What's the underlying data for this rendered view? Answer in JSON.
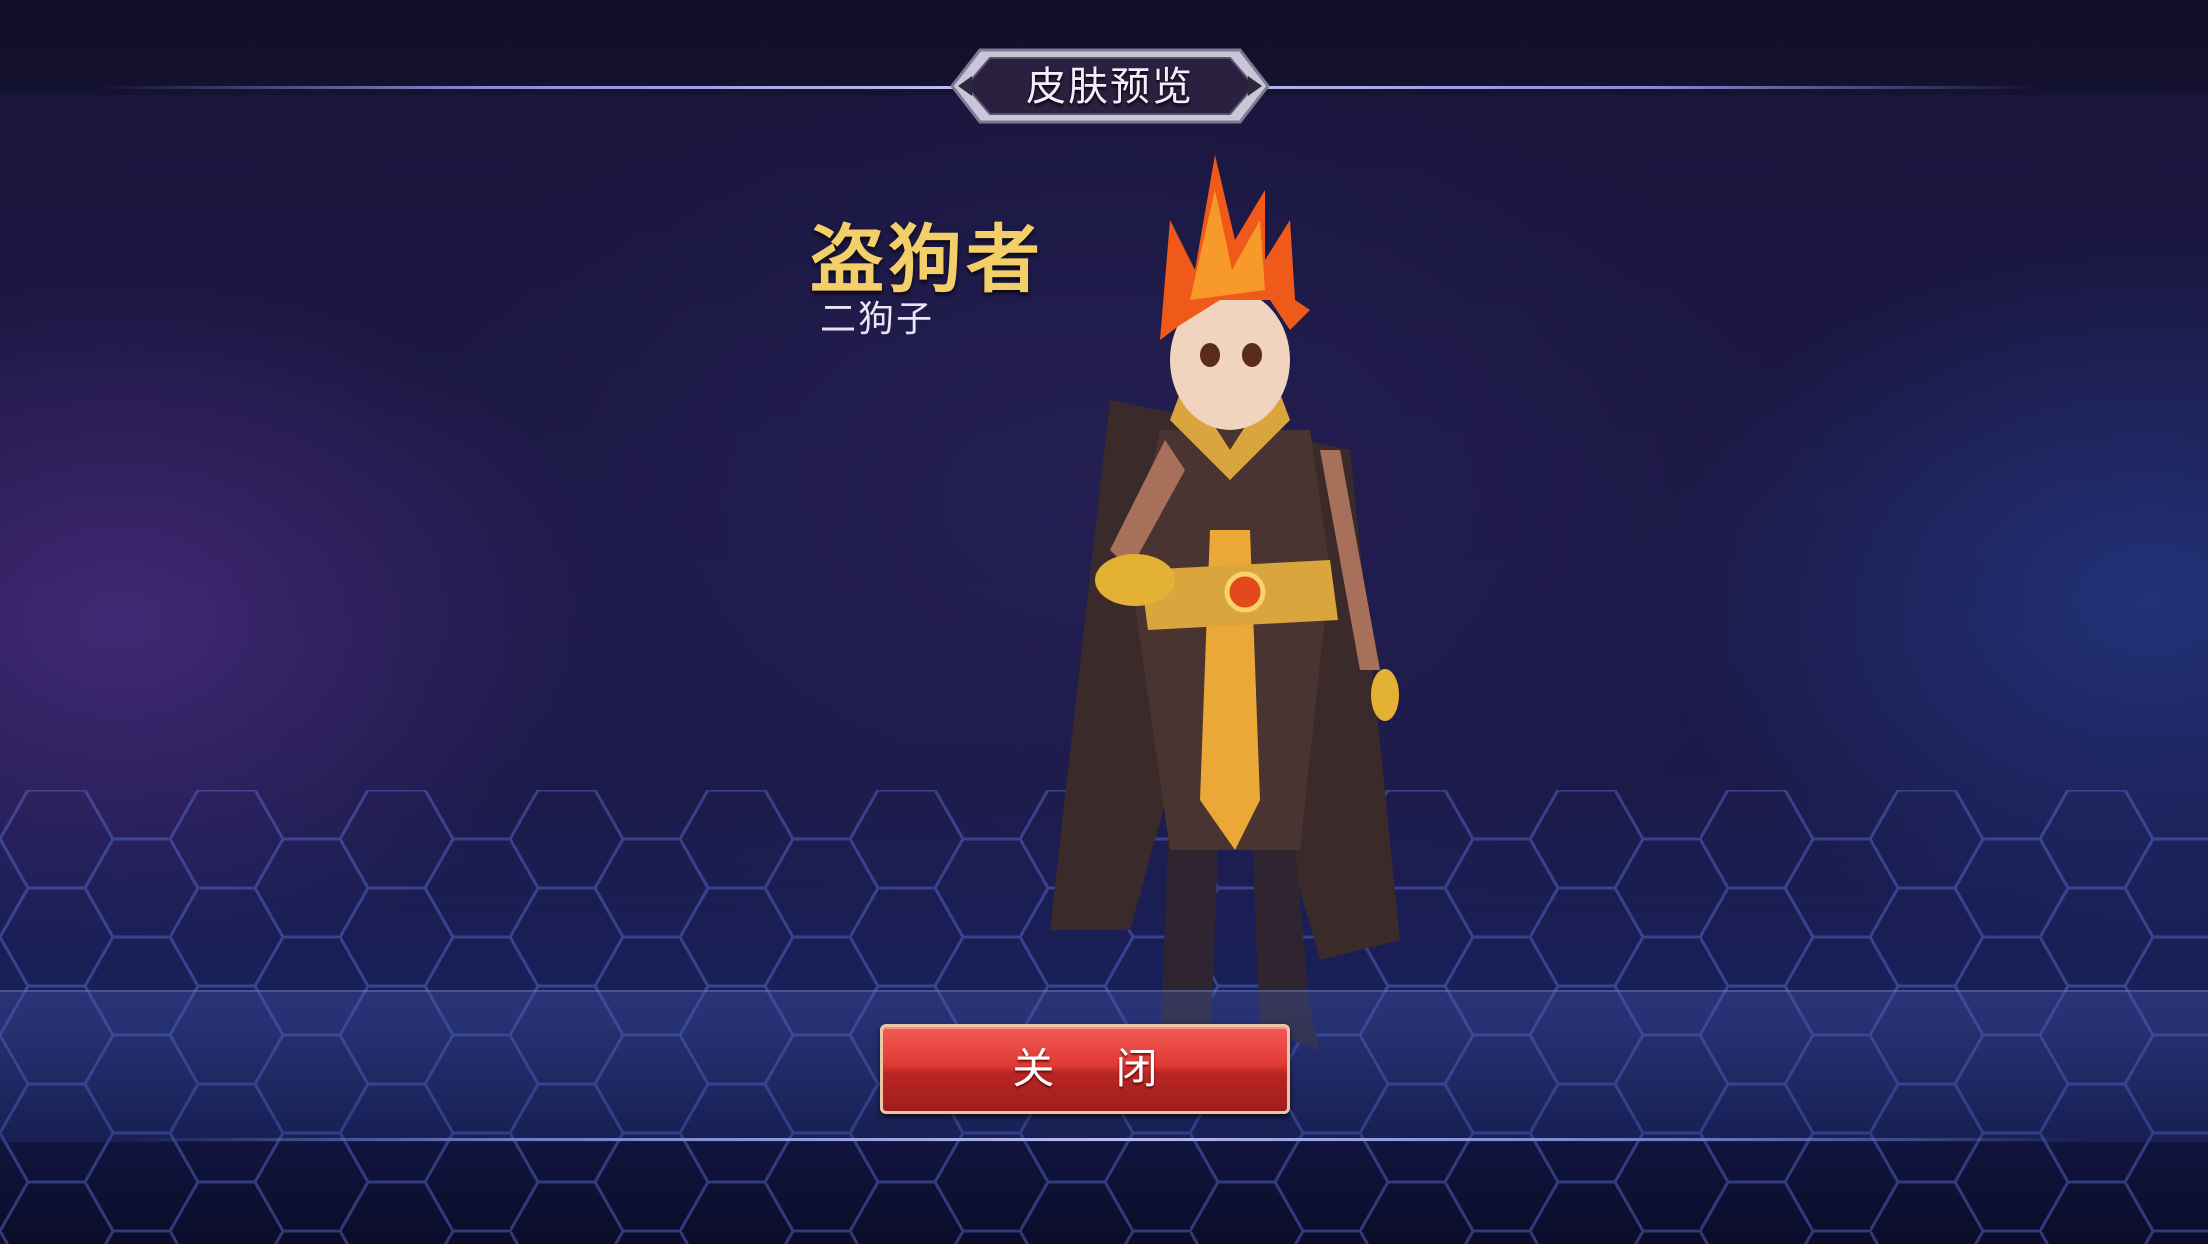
{
  "header": {
    "title": "皮肤预览"
  },
  "skin": {
    "name": "盗狗者",
    "hero": "二狗子"
  },
  "actions": {
    "close_label": "关 闭"
  },
  "colors": {
    "background": "#1b1845",
    "skin_name": "#f3cf6a",
    "close_button": "#d8302d",
    "close_border": "#e9c7a4"
  }
}
